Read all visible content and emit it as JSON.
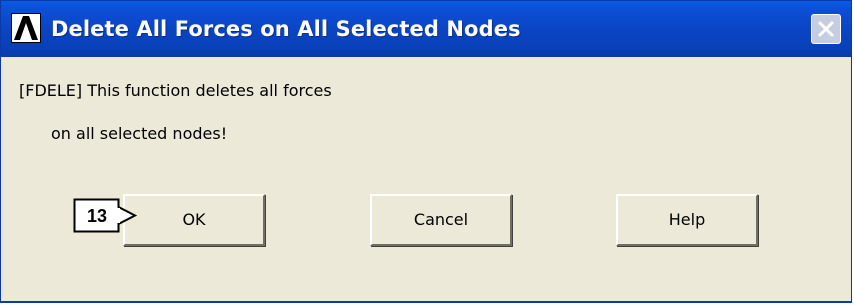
{
  "dialog": {
    "title": "Delete All Forces on All Selected Nodes",
    "app_icon": "ansys-logo-icon",
    "close_icon": "close-icon",
    "message_line_1": "[FDELE]  This function deletes all forces",
    "message_line_2": "on all selected nodes!",
    "buttons": {
      "ok_label": "OK",
      "cancel_label": "Cancel",
      "help_label": "Help"
    }
  },
  "annotation": {
    "step_number": "13"
  },
  "colors": {
    "titlebar": "#0b45c5",
    "dialog_background": "#ece9d8",
    "title_text": "#ffffff"
  }
}
